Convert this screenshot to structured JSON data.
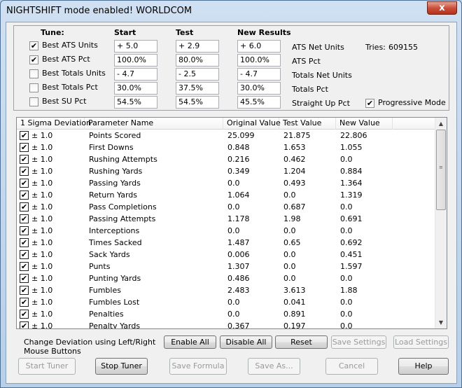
{
  "window": {
    "title": "NIGHTSHIFT mode enabled! WORLDCOM",
    "close_glyph": "x"
  },
  "tune": {
    "headers": {
      "tune": "Tune:",
      "start": "Start",
      "test": "Test",
      "new_results": "New Results"
    },
    "rows": [
      {
        "label": "Best ATS Units",
        "checked": "✔",
        "start": "+ 5.0",
        "test": "+ 2.9",
        "new": "+ 6.0",
        "result_label": "ATS Net Units"
      },
      {
        "label": "Best ATS Pct",
        "checked": "✔",
        "start": "100.0%",
        "test": "80.0%",
        "new": "100.0%",
        "result_label": "ATS Pct"
      },
      {
        "label": "Best Totals Units",
        "checked": "",
        "start": "- 4.7",
        "test": "- 2.5",
        "new": "- 4.7",
        "result_label": "Totals Net Units"
      },
      {
        "label": "Best Totals Pct",
        "checked": "",
        "start": "30.0%",
        "test": "37.5%",
        "new": "30.0%",
        "result_label": "Totals Pct"
      },
      {
        "label": "Best SU Pct",
        "checked": "",
        "start": "54.5%",
        "test": "54.5%",
        "new": "45.5%",
        "result_label": "Straight Up Pct"
      }
    ],
    "tries_label": "Tries:",
    "tries_value": "609155",
    "progressive_label": "Progressive Mode",
    "progressive_checked": "✔"
  },
  "table": {
    "columns": [
      "1 Sigma Deviation",
      "Parameter Name",
      "Original Value",
      "Test Value",
      "New Value"
    ],
    "check_glyph": "✔",
    "rows": [
      {
        "dev": "± 1.0",
        "name": "Points Scored",
        "orig": "25.099",
        "test": "21.875",
        "new": "22.806"
      },
      {
        "dev": "± 1.0",
        "name": "First Downs",
        "orig": "0.848",
        "test": "1.653",
        "new": "1.055"
      },
      {
        "dev": "± 1.0",
        "name": "Rushing Attempts",
        "orig": "0.216",
        "test": "0.462",
        "new": "0.0"
      },
      {
        "dev": "± 1.0",
        "name": "Rushing Yards",
        "orig": "0.349",
        "test": "1.204",
        "new": "0.884"
      },
      {
        "dev": "± 1.0",
        "name": "Passing Yards",
        "orig": "0.0",
        "test": "0.493",
        "new": "1.364"
      },
      {
        "dev": "± 1.0",
        "name": "Return Yards",
        "orig": "1.064",
        "test": "0.0",
        "new": "1.319"
      },
      {
        "dev": "± 1.0",
        "name": "Pass Completions",
        "orig": "0.0",
        "test": "0.687",
        "new": "0.0"
      },
      {
        "dev": "± 1.0",
        "name": "Passing Attempts",
        "orig": "1.178",
        "test": "1.98",
        "new": "0.691"
      },
      {
        "dev": "± 1.0",
        "name": "Interceptions",
        "orig": "0.0",
        "test": "0.0",
        "new": "0.0"
      },
      {
        "dev": "± 1.0",
        "name": "Times Sacked",
        "orig": "1.487",
        "test": "0.65",
        "new": "0.692"
      },
      {
        "dev": "± 1.0",
        "name": "Sack Yards",
        "orig": "0.006",
        "test": "0.0",
        "new": "0.451"
      },
      {
        "dev": "± 1.0",
        "name": "Punts",
        "orig": "1.307",
        "test": "0.0",
        "new": "1.597"
      },
      {
        "dev": "± 1.0",
        "name": "Punting Yards",
        "orig": "0.486",
        "test": "0.0",
        "new": "0.0"
      },
      {
        "dev": "± 1.0",
        "name": "Fumbles",
        "orig": "2.483",
        "test": "3.613",
        "new": "1.88"
      },
      {
        "dev": "± 1.0",
        "name": "Fumbles Lost",
        "orig": "0.0",
        "test": "0.041",
        "new": "0.0"
      },
      {
        "dev": "± 1.0",
        "name": "Penalties",
        "orig": "0.0",
        "test": "0.891",
        "new": "0.0"
      },
      {
        "dev": "± 1.0",
        "name": "Penalty Yards",
        "orig": "0.367",
        "test": "0.197",
        "new": "0.0"
      }
    ],
    "scroll_up": "▲",
    "scroll_down": "▼",
    "grip": "≡"
  },
  "footer": {
    "hint": "Change Deviation using Left/Right Mouse Buttons",
    "enable_all": "Enable All",
    "disable_all": "Disable All",
    "reset": "Reset",
    "save_settings": "Save Settings",
    "load_settings": "Load Settings",
    "start_tuner": "Start Tuner",
    "stop_tuner": "Stop Tuner",
    "save_formula": "Save Formula",
    "save_as": "Save As...",
    "cancel": "Cancel",
    "help": "Help"
  }
}
